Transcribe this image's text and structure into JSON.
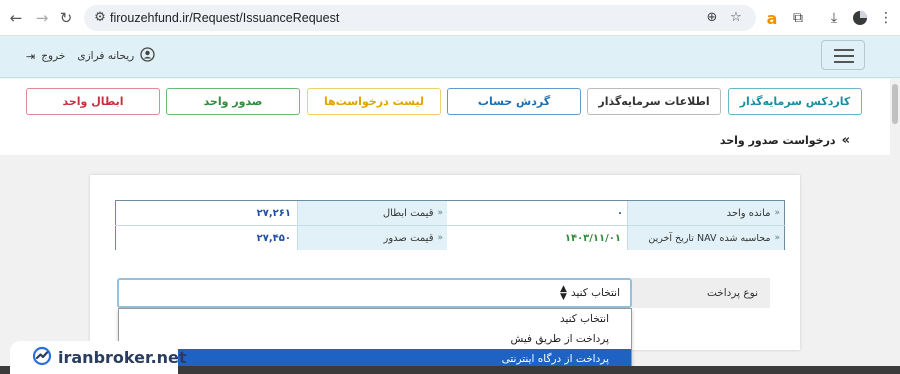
{
  "browser": {
    "url": "firouzehfund.ir/Request/IssuanceRequest",
    "icons": [
      "back-arrow-icon",
      "forward-arrow-icon",
      "reload-icon",
      "site-settings-icon",
      "zoom-icon",
      "star-icon",
      "amazon-extension-icon",
      "extensions-puzzle-icon",
      "download-icon",
      "profile-icon",
      "kebab-menu-icon"
    ],
    "amazon_letter": "a"
  },
  "header": {
    "user_name": "ریحانه فرازی",
    "logout_label": "خروج"
  },
  "menu": [
    {
      "label": "کاردکس سرمایه‌گذار",
      "color": "#1a8ea3",
      "border": "#68b8c8"
    },
    {
      "label": "اطلاعات سرمایه‌گذار",
      "color": "#333333",
      "border": "#bbbbbb"
    },
    {
      "label": "گردش حساب",
      "color": "#1e6fb0",
      "border": "#5f9bd0"
    },
    {
      "label": "لیست درخواست‌ها",
      "color": "#e0a400",
      "border": "#efcf6e"
    },
    {
      "label": "صدور واحد",
      "color": "#2e8b3a",
      "border": "#6dba77"
    },
    {
      "label": "ابطال واحد",
      "color": "#c6303e",
      "border": "#e08a93"
    }
  ],
  "breadcrumb": {
    "arrow": "»",
    "title": "درخواست صدور واحد"
  },
  "info": {
    "bullet": "»",
    "remaining_units_label": "مانده واحد",
    "remaining_units_value": "۰",
    "redemption_price_label": "قیمت ابطال",
    "redemption_price_value": "۲۷,۲۶۱",
    "last_nav_date_label": "تاریخ آخرین NAV محاسبه شده",
    "last_nav_date_value": "۱۴۰۳/۱۱/۰۱",
    "issue_price_label": "قیمت صدور",
    "issue_price_value": "۲۷,۴۵۰"
  },
  "payment": {
    "label": "نوع پرداخت",
    "selected": "انتخاب کنید",
    "options": [
      "انتخاب کنید",
      "پرداخت از طریق فیش",
      "پرداخت از درگاه اینترنتی"
    ],
    "highlighted_index": 2
  },
  "watermark": {
    "text": "iranbroker.net"
  },
  "colors": {
    "header_bg": "#dff0f6",
    "label_cell_bg": "#e2f1f7",
    "value_blue": "#1e4fa0",
    "value_green": "#2e8b3a",
    "select_highlight": "#1e63c4"
  }
}
